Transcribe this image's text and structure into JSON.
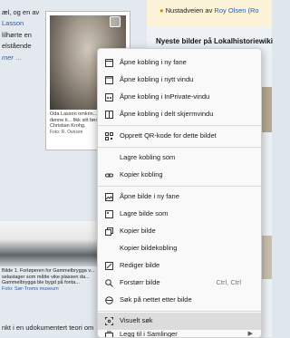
{
  "left": {
    "line1": "æl, og en av",
    "line2_link": "Lasson",
    "line3": "lilhørte en",
    "line4": "elstående",
    "more_link": "mer …",
    "photo1_caption": "Oda Lasson omkrin... Det var på denne ti... fikk sitt første barn r... Christian Krohg.",
    "photo1_credit": "Foto: R. Ovesen",
    "photo2_caption": "Bilde 1. Forløperen for Gammelbrygga v... selastager som måtte vike plassen da... Gammelbrygga ble bygd på fonta...",
    "photo2_credit": "Foto: Sør-Troms museum",
    "bottom_text": "nkt i en udokumentert teori om"
  },
  "right": {
    "news_prefix": "Nustadveien av ",
    "news_link": "Roy Olsen (Ro",
    "heading": "Nyeste bilder på Lokalhistoriewiki"
  },
  "menu": {
    "items": [
      {
        "label": "Åpne kobling i ny fane",
        "icon": "new-tab-icon"
      },
      {
        "label": "Åpne kobling i nytt vindu",
        "icon": "new-window-icon"
      },
      {
        "label": "Åpne kobling i InPrivate-vindu",
        "icon": "inprivate-icon"
      },
      {
        "label": "Åpne kobling i delt skjermvindu",
        "icon": "split-screen-icon"
      },
      {
        "label": "Opprett QR-kode for dette bildet",
        "icon": "qr-code-icon"
      },
      {
        "label": "Lagre kobling som",
        "icon": "none"
      },
      {
        "label": "Kopier kobling",
        "icon": "link-icon"
      },
      {
        "label": "Åpne bilde i ny fane",
        "icon": "open-image-icon"
      },
      {
        "label": "Lagre bilde som",
        "icon": "save-image-icon"
      },
      {
        "label": "Kopier bilde",
        "icon": "copy-image-icon"
      },
      {
        "label": "Kopier bildekobling",
        "icon": "none"
      },
      {
        "label": "Rediger bilde",
        "icon": "edit-image-icon"
      },
      {
        "label": "Forstørr bilde",
        "icon": "magnify-icon",
        "shortcut": "Ctrl, Ctrl"
      },
      {
        "label": "Søk på nettet etter bilde",
        "icon": "search-web-icon"
      },
      {
        "label": "Visuelt søk",
        "icon": "visual-search-icon"
      },
      {
        "label": "Legg til i Samlinger",
        "icon": "collections-icon"
      }
    ]
  }
}
